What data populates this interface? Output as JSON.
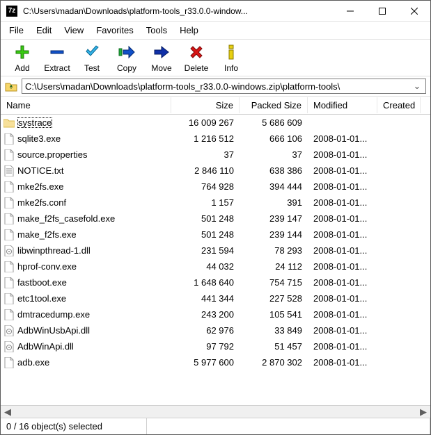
{
  "title": "C:\\Users\\madan\\Downloads\\platform-tools_r33.0.0-window...",
  "menu": {
    "file": "File",
    "edit": "Edit",
    "view": "View",
    "favorites": "Favorites",
    "tools": "Tools",
    "help": "Help"
  },
  "toolbar": {
    "add": "Add",
    "extract": "Extract",
    "test": "Test",
    "copy": "Copy",
    "move": "Move",
    "delete": "Delete",
    "info": "Info"
  },
  "path": "C:\\Users\\madan\\Downloads\\platform-tools_r33.0.0-windows.zip\\platform-tools\\",
  "columns": {
    "name": "Name",
    "size": "Size",
    "packed": "Packed Size",
    "modified": "Modified",
    "created": "Created"
  },
  "files": [
    {
      "icon": "folder",
      "name": "systrace",
      "size": "16 009 267",
      "packed": "5 686 609",
      "mod": ""
    },
    {
      "icon": "exe",
      "name": "sqlite3.exe",
      "size": "1 216 512",
      "packed": "666 106",
      "mod": "2008-01-01..."
    },
    {
      "icon": "file",
      "name": "source.properties",
      "size": "37",
      "packed": "37",
      "mod": "2008-01-01..."
    },
    {
      "icon": "txt",
      "name": "NOTICE.txt",
      "size": "2 846 110",
      "packed": "638 386",
      "mod": "2008-01-01..."
    },
    {
      "icon": "exe",
      "name": "mke2fs.exe",
      "size": "764 928",
      "packed": "394 444",
      "mod": "2008-01-01..."
    },
    {
      "icon": "file",
      "name": "mke2fs.conf",
      "size": "1 157",
      "packed": "391",
      "mod": "2008-01-01..."
    },
    {
      "icon": "exe",
      "name": "make_f2fs_casefold.exe",
      "size": "501 248",
      "packed": "239 147",
      "mod": "2008-01-01..."
    },
    {
      "icon": "exe",
      "name": "make_f2fs.exe",
      "size": "501 248",
      "packed": "239 144",
      "mod": "2008-01-01..."
    },
    {
      "icon": "dll",
      "name": "libwinpthread-1.dll",
      "size": "231 594",
      "packed": "78 293",
      "mod": "2008-01-01..."
    },
    {
      "icon": "exe",
      "name": "hprof-conv.exe",
      "size": "44 032",
      "packed": "24 112",
      "mod": "2008-01-01..."
    },
    {
      "icon": "exe",
      "name": "fastboot.exe",
      "size": "1 648 640",
      "packed": "754 715",
      "mod": "2008-01-01..."
    },
    {
      "icon": "exe",
      "name": "etc1tool.exe",
      "size": "441 344",
      "packed": "227 528",
      "mod": "2008-01-01..."
    },
    {
      "icon": "exe",
      "name": "dmtracedump.exe",
      "size": "243 200",
      "packed": "105 541",
      "mod": "2008-01-01..."
    },
    {
      "icon": "dll",
      "name": "AdbWinUsbApi.dll",
      "size": "62 976",
      "packed": "33 849",
      "mod": "2008-01-01..."
    },
    {
      "icon": "dll",
      "name": "AdbWinApi.dll",
      "size": "97 792",
      "packed": "51 457",
      "mod": "2008-01-01..."
    },
    {
      "icon": "exe",
      "name": "adb.exe",
      "size": "5 977 600",
      "packed": "2 870 302",
      "mod": "2008-01-01..."
    }
  ],
  "status": "0 / 16 object(s) selected"
}
